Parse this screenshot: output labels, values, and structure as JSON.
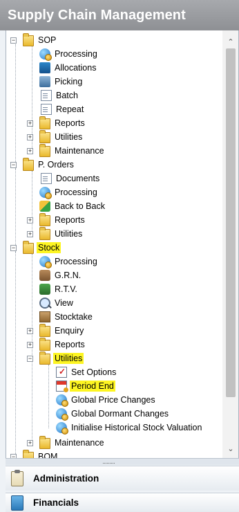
{
  "panel": {
    "title": "Supply Chain Management"
  },
  "tree": {
    "nodes": [
      {
        "label": "SOP",
        "toggle": "−"
      },
      {
        "label": "Processing"
      },
      {
        "label": "Allocations"
      },
      {
        "label": "Picking"
      },
      {
        "label": "Batch"
      },
      {
        "label": "Repeat"
      },
      {
        "label": "Reports",
        "toggle": "+"
      },
      {
        "label": "Utilities",
        "toggle": "+"
      },
      {
        "label": "Maintenance",
        "toggle": "+"
      },
      {
        "label": "P. Orders",
        "toggle": "−"
      },
      {
        "label": "Documents"
      },
      {
        "label": "Processing"
      },
      {
        "label": "Back to Back"
      },
      {
        "label": "Reports",
        "toggle": "+"
      },
      {
        "label": "Utilities",
        "toggle": "+"
      },
      {
        "label": "Stock",
        "toggle": "−",
        "highlighted": true
      },
      {
        "label": "Processing"
      },
      {
        "label": "G.R.N."
      },
      {
        "label": "R.T.V."
      },
      {
        "label": "View"
      },
      {
        "label": "Stocktake"
      },
      {
        "label": "Enquiry",
        "toggle": "+"
      },
      {
        "label": "Reports",
        "toggle": "+"
      },
      {
        "label": "Utilities",
        "toggle": "−",
        "highlighted": true
      },
      {
        "label": "Set Options"
      },
      {
        "label": "Period End",
        "highlighted": true
      },
      {
        "label": "Global Price Changes"
      },
      {
        "label": "Global Dormant Changes"
      },
      {
        "label": "Initialise Historical Stock Valuation"
      },
      {
        "label": "Maintenance",
        "toggle": "+"
      },
      {
        "label": "BOM",
        "toggle": "−"
      }
    ]
  },
  "nav": {
    "administration": "Administration",
    "financials": "Financials"
  },
  "colors": {
    "highlight": "#fdf522",
    "header": "#9a9c9f"
  },
  "icons": {
    "folder": "folder-icon",
    "process": "globe-process-icon",
    "document": "document-icon"
  }
}
